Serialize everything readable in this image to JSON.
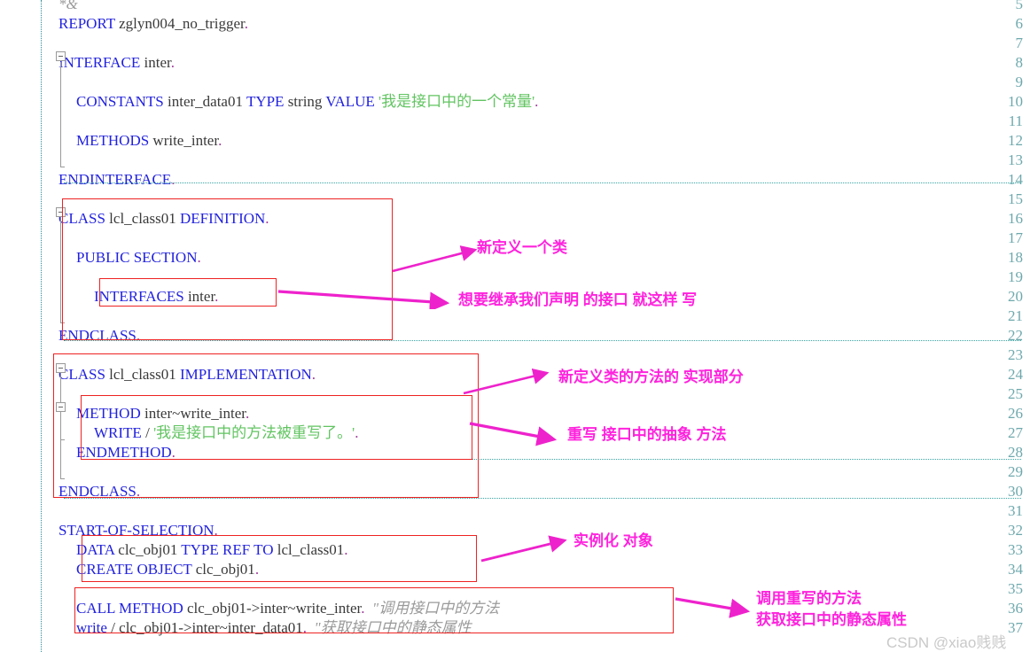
{
  "editor": {
    "language": "ABAP",
    "first_visible_line": 5,
    "last_visible_line": 37,
    "colors": {
      "keyword": "#2222dd",
      "identifier": "#3a3a3a",
      "string": "#62c462",
      "comment": "#9a9a9a",
      "line_number": "#6ea8ad",
      "annotation_box": "#ee2222",
      "annotation_text": "#ff22dd",
      "background": "#ffffff"
    },
    "lines": [
      {
        "n": 5,
        "indent": 1,
        "tokens": [
          {
            "t": "*&",
            "c": "cmt"
          }
        ]
      },
      {
        "n": 6,
        "indent": 1,
        "tokens": [
          {
            "t": "REPORT",
            "c": "kw"
          },
          {
            "t": " zglyn004_no_trigger",
            "c": "id"
          },
          {
            "t": ".",
            "c": "punc"
          }
        ]
      },
      {
        "n": 7,
        "indent": 1,
        "tokens": []
      },
      {
        "n": 8,
        "indent": 1,
        "tokens": [
          {
            "t": "INTERFACE",
            "c": "kw"
          },
          {
            "t": " inter",
            "c": "id"
          },
          {
            "t": ".",
            "c": "punc"
          }
        ]
      },
      {
        "n": 9,
        "indent": 1,
        "tokens": []
      },
      {
        "n": 10,
        "indent": 3,
        "tokens": [
          {
            "t": "CONSTANTS",
            "c": "kw"
          },
          {
            "t": " inter_data01 ",
            "c": "id"
          },
          {
            "t": "TYPE",
            "c": "kw"
          },
          {
            "t": " string ",
            "c": "id"
          },
          {
            "t": "VALUE",
            "c": "kw"
          },
          {
            "t": " '我是接口中的一个常量'",
            "c": "str"
          },
          {
            "t": ".",
            "c": "punc"
          }
        ]
      },
      {
        "n": 11,
        "indent": 3,
        "tokens": []
      },
      {
        "n": 12,
        "indent": 3,
        "tokens": [
          {
            "t": "METHODS",
            "c": "kw"
          },
          {
            "t": " write_inter",
            "c": "id"
          },
          {
            "t": ".",
            "c": "punc"
          }
        ]
      },
      {
        "n": 13,
        "indent": 3,
        "tokens": []
      },
      {
        "n": 14,
        "indent": 1,
        "tokens": [
          {
            "t": "ENDINTERFACE",
            "c": "kw"
          },
          {
            "t": ".",
            "c": "punc"
          }
        ]
      },
      {
        "n": 15,
        "indent": 1,
        "tokens": []
      },
      {
        "n": 16,
        "indent": 1,
        "tokens": [
          {
            "t": "CLASS",
            "c": "kw"
          },
          {
            "t": " lcl_class01 ",
            "c": "id"
          },
          {
            "t": "DEFINITION",
            "c": "kw"
          },
          {
            "t": ".",
            "c": "punc"
          }
        ]
      },
      {
        "n": 17,
        "indent": 1,
        "tokens": []
      },
      {
        "n": 18,
        "indent": 3,
        "tokens": [
          {
            "t": "PUBLIC SECTION",
            "c": "kw"
          },
          {
            "t": ".",
            "c": "punc"
          }
        ]
      },
      {
        "n": 19,
        "indent": 3,
        "tokens": []
      },
      {
        "n": 20,
        "indent": 5,
        "tokens": [
          {
            "t": "INTERFACES",
            "c": "kw"
          },
          {
            "t": " inter",
            "c": "id"
          },
          {
            "t": ".",
            "c": "punc"
          }
        ]
      },
      {
        "n": 21,
        "indent": 5,
        "tokens": []
      },
      {
        "n": 22,
        "indent": 1,
        "tokens": [
          {
            "t": "ENDCLASS",
            "c": "kw"
          },
          {
            "t": ".",
            "c": "punc"
          }
        ]
      },
      {
        "n": 23,
        "indent": 1,
        "tokens": []
      },
      {
        "n": 24,
        "indent": 1,
        "tokens": [
          {
            "t": "CLASS",
            "c": "kw"
          },
          {
            "t": " lcl_class01 ",
            "c": "id"
          },
          {
            "t": "IMPLEMENTATION",
            "c": "kw"
          },
          {
            "t": ".",
            "c": "punc"
          }
        ]
      },
      {
        "n": 25,
        "indent": 1,
        "tokens": []
      },
      {
        "n": 26,
        "indent": 3,
        "tokens": [
          {
            "t": "METHOD",
            "c": "kw"
          },
          {
            "t": " inter~write_inter",
            "c": "id"
          },
          {
            "t": ".",
            "c": "punc"
          }
        ]
      },
      {
        "n": 27,
        "indent": 5,
        "tokens": [
          {
            "t": "WRITE",
            "c": "kw"
          },
          {
            "t": " / ",
            "c": "id"
          },
          {
            "t": "'我是接口中的方法被重写了。'",
            "c": "str"
          },
          {
            "t": ".",
            "c": "punc"
          }
        ]
      },
      {
        "n": 28,
        "indent": 3,
        "tokens": [
          {
            "t": "ENDMETHOD",
            "c": "kw"
          },
          {
            "t": ".",
            "c": "punc"
          }
        ]
      },
      {
        "n": 29,
        "indent": 3,
        "tokens": []
      },
      {
        "n": 30,
        "indent": 1,
        "tokens": [
          {
            "t": "ENDCLASS",
            "c": "kw"
          },
          {
            "t": ".",
            "c": "punc"
          }
        ]
      },
      {
        "n": 31,
        "indent": 1,
        "tokens": []
      },
      {
        "n": 32,
        "indent": 1,
        "tokens": [
          {
            "t": "START-OF-SELECTION",
            "c": "kw"
          },
          {
            "t": ".",
            "c": "punc"
          }
        ]
      },
      {
        "n": 33,
        "indent": 3,
        "tokens": [
          {
            "t": "DATA",
            "c": "kw"
          },
          {
            "t": " clc_obj01 ",
            "c": "id"
          },
          {
            "t": "TYPE REF TO",
            "c": "kw"
          },
          {
            "t": " lcl_class01",
            "c": "id"
          },
          {
            "t": ".",
            "c": "punc"
          }
        ]
      },
      {
        "n": 34,
        "indent": 3,
        "tokens": [
          {
            "t": "CREATE OBJECT",
            "c": "kw"
          },
          {
            "t": " clc_obj01",
            "c": "id"
          },
          {
            "t": ".",
            "c": "punc"
          }
        ]
      },
      {
        "n": 35,
        "indent": 3,
        "tokens": []
      },
      {
        "n": 36,
        "indent": 3,
        "tokens": [
          {
            "t": "CALL METHOD",
            "c": "kw"
          },
          {
            "t": " clc_obj01->inter~write_inter",
            "c": "id"
          },
          {
            "t": ".",
            "c": "punc"
          },
          {
            "t": "  \"调用接口中的方法",
            "c": "cmt"
          }
        ]
      },
      {
        "n": 37,
        "indent": 3,
        "tokens": [
          {
            "t": "write",
            "c": "kw"
          },
          {
            "t": " / clc_obj01->inter~inter_data01",
            "c": "id"
          },
          {
            "t": ".",
            "c": "punc"
          },
          {
            "t": "  \"获取接口中的静态属性",
            "c": "cmt"
          }
        ]
      }
    ]
  },
  "annotations": [
    {
      "id": "new-class",
      "text": "新定义一个类"
    },
    {
      "id": "inherit-interface",
      "text": "想要继承我们声明 的接口 就这样 写"
    },
    {
      "id": "impl-part",
      "text": "新定义类的方法的 实现部分"
    },
    {
      "id": "override-abstract",
      "text": "重写 接口中的抽象 方法"
    },
    {
      "id": "instantiate-object",
      "text": "实例化 对象"
    },
    {
      "id": "call-override",
      "text": "调用重写的方法"
    },
    {
      "id": "get-static-prop",
      "text": "获取接口中的静态属性"
    }
  ],
  "watermark": {
    "text": "CSDN @xiao贱贱"
  }
}
